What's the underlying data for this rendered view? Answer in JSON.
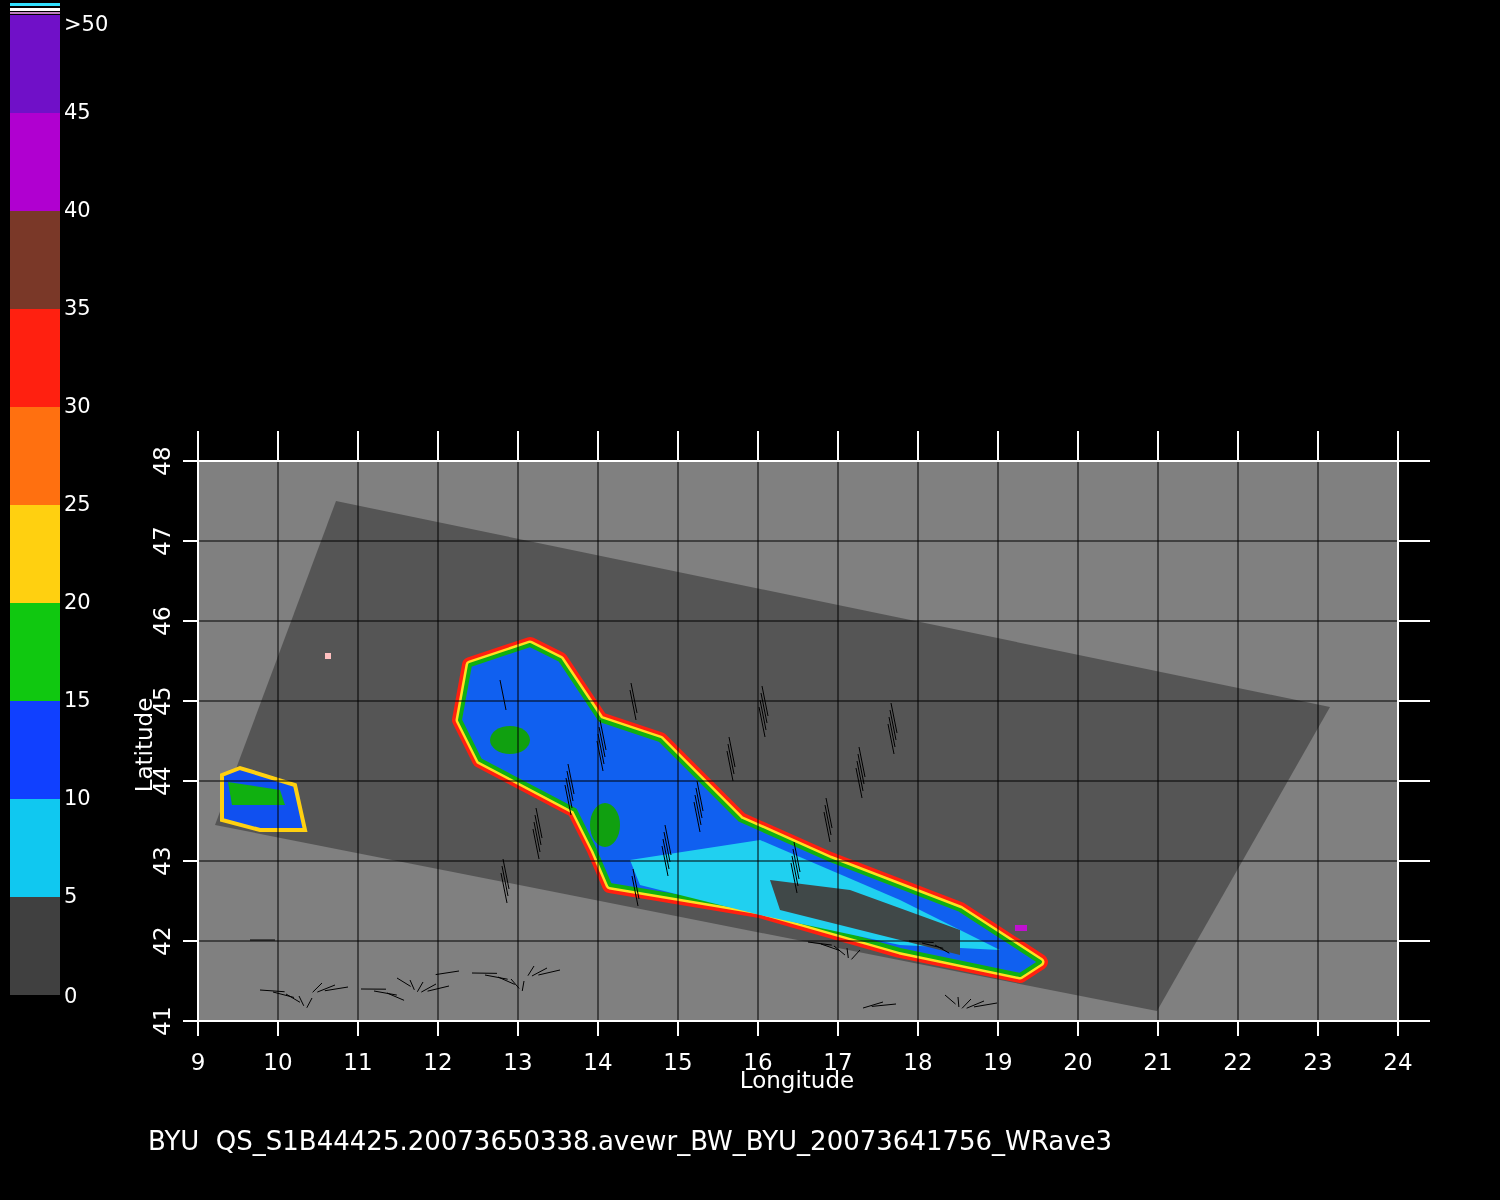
{
  "colorbar": {
    "segments": [
      {
        "label": ">50",
        "color": "#7010c8"
      },
      {
        "label": "45",
        "color": "#b000d0"
      },
      {
        "label": "40",
        "color": "#7a3828"
      },
      {
        "label": "35",
        "color": "#ff2010"
      },
      {
        "label": "30",
        "color": "#ff7010"
      },
      {
        "label": "25",
        "color": "#ffd010"
      },
      {
        "label": "20",
        "color": "#10c810"
      },
      {
        "label": "15",
        "color": "#1040ff"
      },
      {
        "label": "10",
        "color": "#10c8f0"
      },
      {
        "label": "5",
        "color": "#404040"
      }
    ],
    "min_label": "0"
  },
  "plot": {
    "longitude_ticks": [
      "9",
      "10",
      "11",
      "12",
      "13",
      "14",
      "15",
      "16",
      "17",
      "18",
      "19",
      "20",
      "21",
      "22",
      "23",
      "24"
    ],
    "latitude_ticks": [
      "41",
      "42",
      "43",
      "44",
      "45",
      "46",
      "47",
      "48"
    ],
    "xlabel": "Longitude",
    "ylabel": "Latitude"
  },
  "caption": "BYU  QS_S1B44425.20073650338.avewr_BW_BYU_20073641756_WRave3"
}
